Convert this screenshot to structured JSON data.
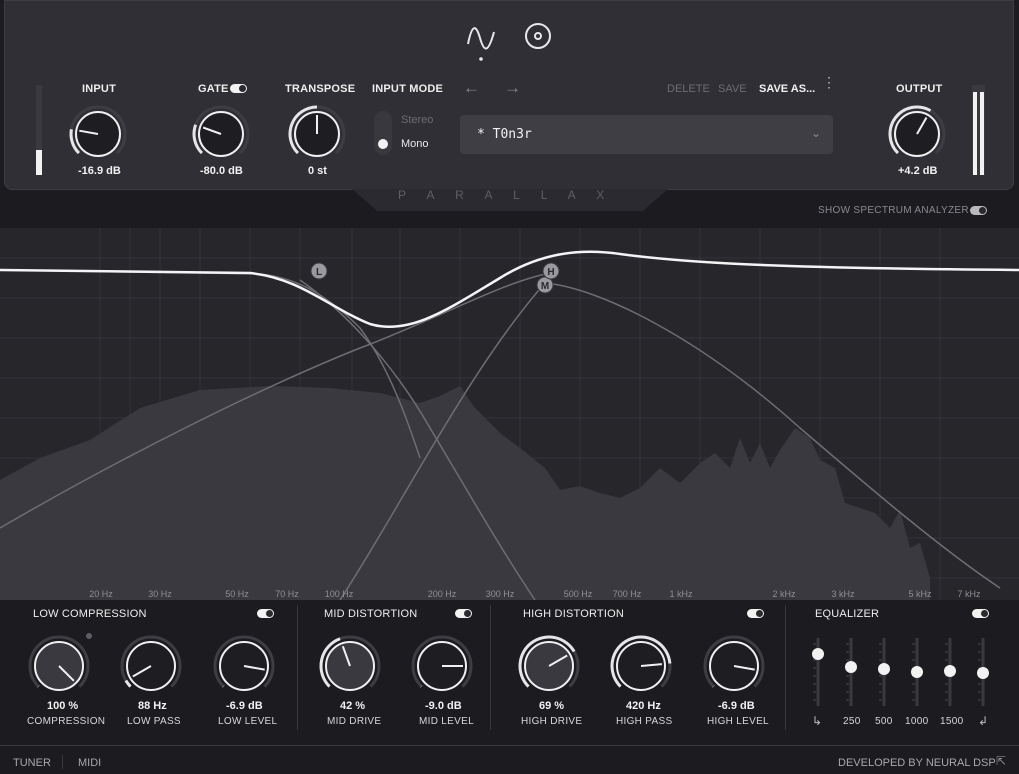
{
  "header": {
    "icons": [
      "waveform-icon",
      "circle-target-icon"
    ],
    "brand": "P A R A L L A X"
  },
  "input": {
    "label": "INPUT",
    "value": "-16.9 dB",
    "level": 0.28
  },
  "gate": {
    "label": "GATE",
    "value": "-80.0 dB",
    "enabled": true
  },
  "transpose": {
    "label": "TRANSPOSE",
    "value": "0 st"
  },
  "input_mode": {
    "label": "INPUT MODE",
    "options": [
      "Stereo",
      "Mono"
    ],
    "selected": "Mono"
  },
  "preset": {
    "name": "* T0n3r",
    "delete_label": "DELETE",
    "save_label": "SAVE",
    "save_as_label": "SAVE AS..."
  },
  "output": {
    "label": "OUTPUT",
    "value": "+4.2 dB",
    "level": 0.92
  },
  "spectrum": {
    "toggle_label": "SHOW SPECTRUM ANALYZER",
    "enabled": true
  },
  "graph": {
    "nodes": [
      "L",
      "M",
      "H"
    ],
    "freq_labels": [
      "20 Hz",
      "30 Hz",
      "50 Hz",
      "70 Hz",
      "100 Hz",
      "200 Hz",
      "300 Hz",
      "500 Hz",
      "700 Hz",
      "1 kHz",
      "2 kHz",
      "3 kHz",
      "5 kHz",
      "7 kHz"
    ]
  },
  "low_compression": {
    "title": "LOW COMPRESSION",
    "enabled": true,
    "knobs": [
      {
        "value": "100 %",
        "label": "COMPRESSION"
      },
      {
        "value": "88 Hz",
        "label": "LOW PASS"
      },
      {
        "value": "-6.9 dB",
        "label": "LOW LEVEL"
      }
    ]
  },
  "mid_distortion": {
    "title": "MID DISTORTION",
    "enabled": true,
    "knobs": [
      {
        "value": "42 %",
        "label": "MID DRIVE"
      },
      {
        "value": "-9.0 dB",
        "label": "MID LEVEL"
      }
    ]
  },
  "high_distortion": {
    "title": "HIGH DISTORTION",
    "enabled": true,
    "knobs": [
      {
        "value": "69 %",
        "label": "HIGH DRIVE"
      },
      {
        "value": "420 Hz",
        "label": "HIGH PASS"
      },
      {
        "value": "-6.9 dB",
        "label": "HIGH LEVEL"
      }
    ]
  },
  "equalizer": {
    "title": "EQUALIZER",
    "enabled": true,
    "bands": [
      "250",
      "500",
      "1000",
      "1500"
    ]
  },
  "footer": {
    "tuner": "TUNER",
    "midi": "MIDI",
    "credit": "DEVELOPED BY NEURAL DSP"
  }
}
